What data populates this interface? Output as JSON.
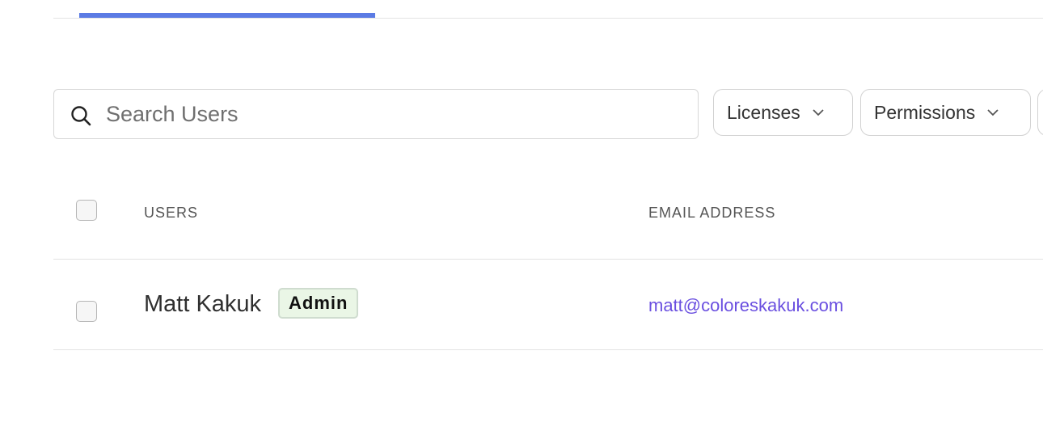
{
  "search": {
    "placeholder": "Search Users",
    "value": ""
  },
  "filters": {
    "licenses_label": "Licenses",
    "permissions_label": "Permissions"
  },
  "table": {
    "columns": [
      "USERS",
      "EMAIL ADDRESS"
    ],
    "rows": [
      {
        "name": "Matt Kakuk",
        "badge": "Admin",
        "email": "matt@coloreskakuk.com",
        "selected": false
      }
    ]
  },
  "colors": {
    "tab_indicator": "#5b7be4",
    "email_link": "#6a4fe0",
    "admin_badge_bg": "#eaf6e6"
  },
  "icons": {
    "search": "search-icon",
    "dropdown": "chevron-down-icon"
  }
}
